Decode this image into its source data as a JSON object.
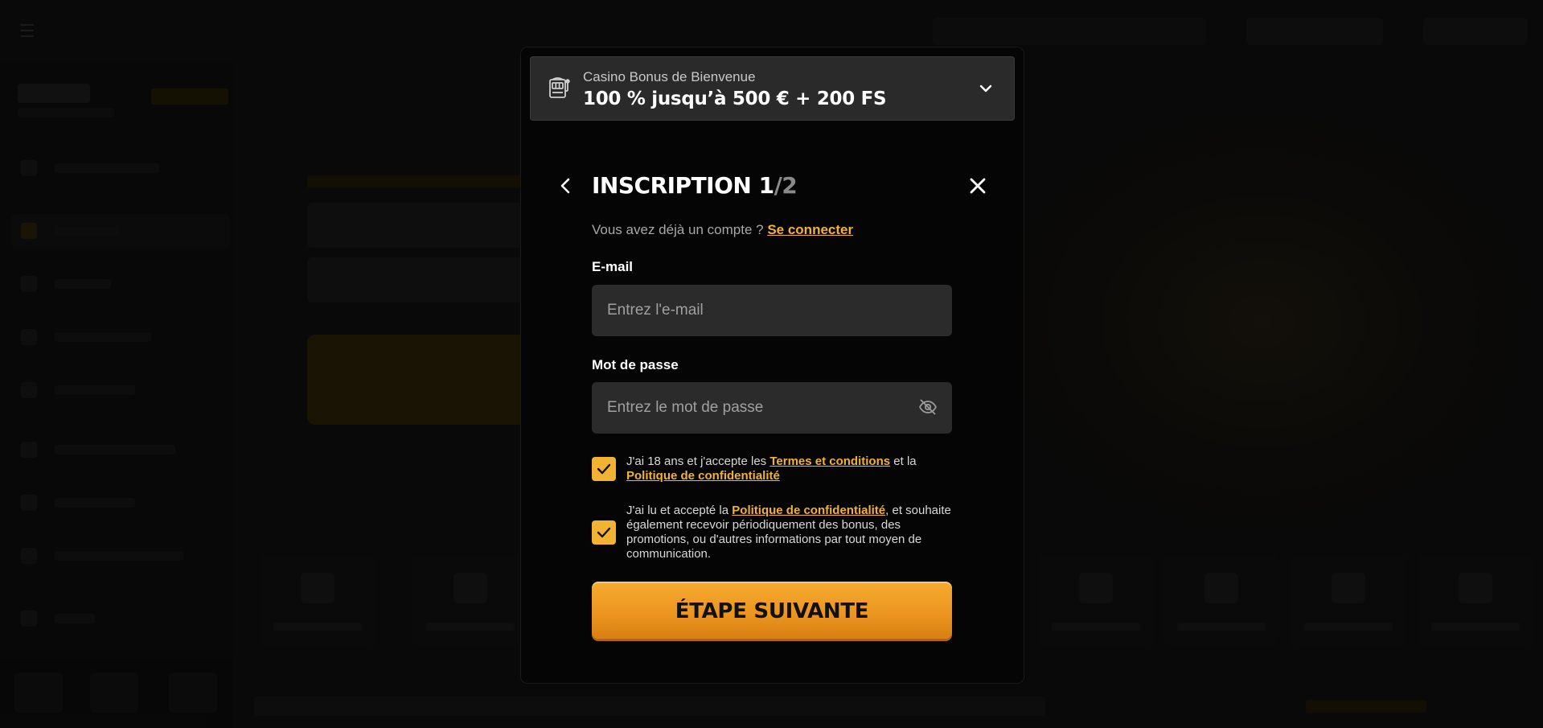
{
  "bonus": {
    "title": "Casino Bonus de Bienvenue",
    "value": "100 % jusqu’à 500 € + 200 FS"
  },
  "form": {
    "title_main": "INSCRIPTION 1",
    "title_total": "/2",
    "have_account_text": "Vous avez déjà un compte ?",
    "login_link": "Se connecter",
    "email": {
      "label": "E-mail",
      "placeholder": "Entrez l'e-mail",
      "value": ""
    },
    "password": {
      "label": "Mot de passe",
      "placeholder": "Entrez le mot de passe",
      "value": ""
    },
    "consent_terms": {
      "checked": true,
      "text_before": "J'ai 18 ans et j'accepte les ",
      "terms_link": "Termes et conditions",
      "text_middle": " et la",
      "privacy_link": "Politique de confidentialité"
    },
    "consent_marketing": {
      "checked": true,
      "text_before": "J'ai lu et accepté la ",
      "privacy_link": "Politique de confidentialité",
      "text_after": ", et souhaite également recevoir périodiquement des bonus, des promotions, ou d'autres informations par tout moyen de communication."
    },
    "next_button": "ÉTAPE SUIVANTE"
  },
  "colors": {
    "accent": "#f2b233",
    "button_gradient_top": "#f5ab2e",
    "button_gradient_bottom": "#d77d12",
    "modal_bg": "#050505",
    "input_bg": "#2b2b2b"
  },
  "icons": {
    "bonus": "slot-machine-icon",
    "expand": "chevron-down-icon",
    "back": "chevron-left-icon",
    "close": "close-icon",
    "password_toggle": "eye-off-icon",
    "checkbox": "checkmark-icon"
  }
}
